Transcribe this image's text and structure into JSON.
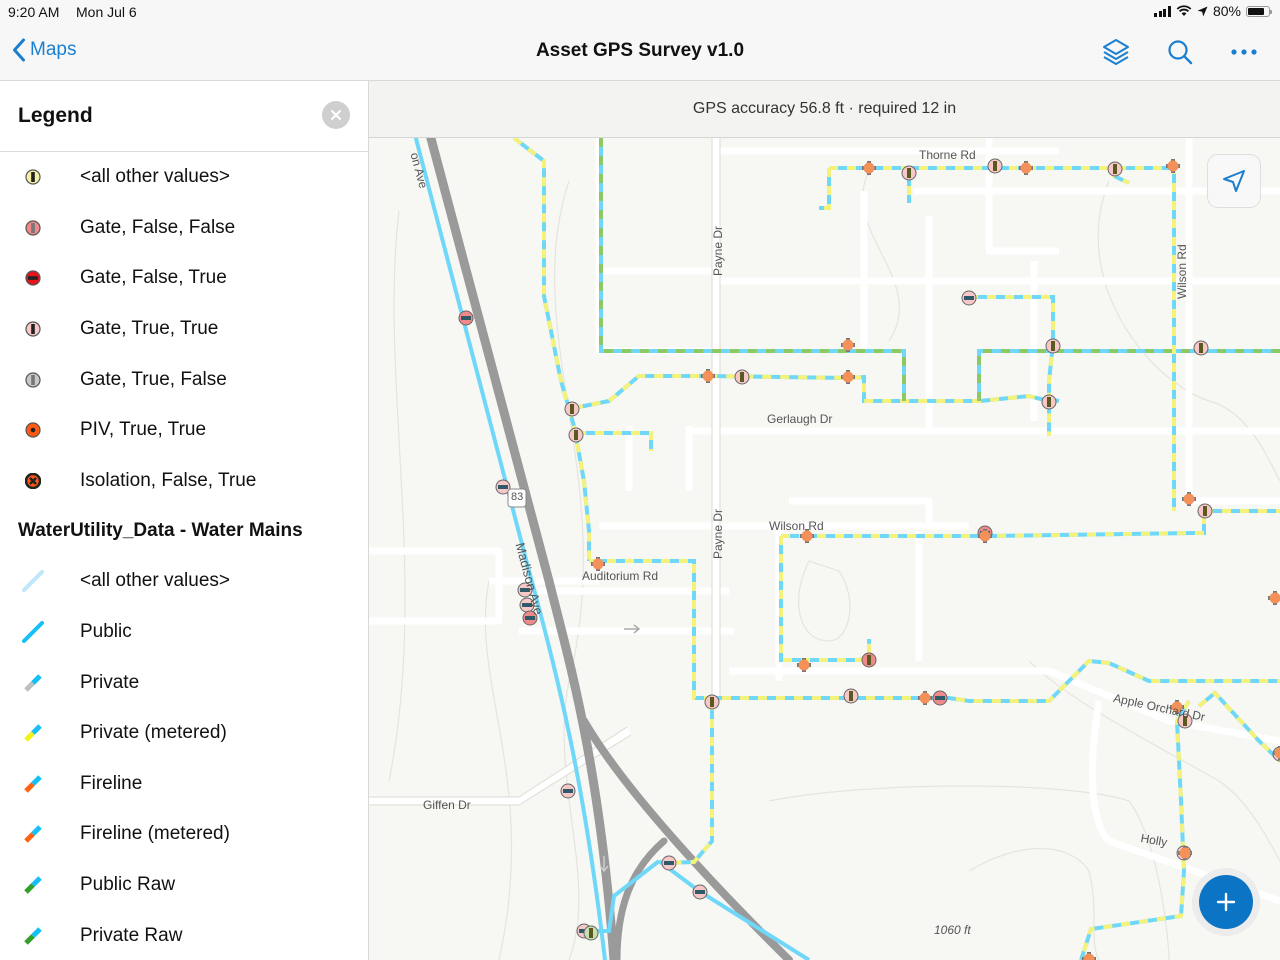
{
  "status_bar": {
    "time": "9:20 AM",
    "date": "Mon Jul 6",
    "battery": "80%",
    "battery_level": 0.8
  },
  "nav": {
    "back_label": "Maps",
    "title": "Asset GPS Survey v1.0",
    "icons": [
      "layers-icon",
      "search-icon",
      "more-icon"
    ]
  },
  "legend": {
    "title": "Legend",
    "valves": [
      {
        "label": "<all other values>",
        "fill": "#f5f0a8",
        "mark": "bar-v"
      },
      {
        "label": "Gate, False, False",
        "fill": "#f08a8a",
        "mark": "bar-v-gray"
      },
      {
        "label": "Gate, False, True",
        "fill": "#e8141a",
        "mark": "bar-h"
      },
      {
        "label": "Gate, True, True",
        "fill": "#f8c8c8",
        "mark": "bar-v"
      },
      {
        "label": "Gate, True, False",
        "fill": "#c8c8c8",
        "mark": "bar-v-gray"
      },
      {
        "label": "PIV, True, True",
        "fill": "#ff5a14",
        "mark": "dot"
      },
      {
        "label": "Isolation, False, True",
        "fill": "#ff5a14",
        "mark": "x"
      }
    ],
    "section_title": "WaterUtility_Data - Water Mains",
    "mains": [
      {
        "label": "<all other values>",
        "color_a": "#bfe6fb",
        "color_b": "#bfe6fb"
      },
      {
        "label": "Public",
        "color_a": "#14c0f5",
        "color_b": "#14c0f5"
      },
      {
        "label": "Private",
        "color_a": "#c0c0c0",
        "color_b": "#14c0f5"
      },
      {
        "label": "Private (metered)",
        "color_a": "#f2f219",
        "color_b": "#14c0f5"
      },
      {
        "label": "Fireline",
        "color_a": "#ff6414",
        "color_b": "#14c0f5"
      },
      {
        "label": "Fireline (metered)",
        "color_a": "#ff6414",
        "color_b": "#14c0f5"
      },
      {
        "label": "Public Raw",
        "color_a": "#32a028",
        "color_b": "#14c0f5"
      },
      {
        "label": "Private Raw",
        "color_a": "#32a028",
        "color_b": "#14c0f5"
      }
    ]
  },
  "map": {
    "gps_status": "GPS accuracy 56.8 ft · required 12 in",
    "labels": {
      "madison_top": "on Ave",
      "madison": "Madison Ave",
      "route": "83",
      "payne_top": "Payne Dr",
      "payne_bottom": "Payne Dr",
      "thorne": "Thorne Rd",
      "wilson_v": "Wilson Rd",
      "wilson_h": "Wilson Rd",
      "gerlaugh": "Gerlaugh Dr",
      "auditorium": "Auditorium Rd",
      "giffen": "Giffen Dr",
      "apple": "Apple Orchard Dr",
      "holly": "Holly",
      "elevation": "1060 ft"
    },
    "colors": {
      "main_blue": "#6fd8f8",
      "main_yellow": "#f4f27a",
      "main_green": "#8cc864",
      "highway": "#9a9a9a",
      "accent": "#0b74c4"
    }
  }
}
